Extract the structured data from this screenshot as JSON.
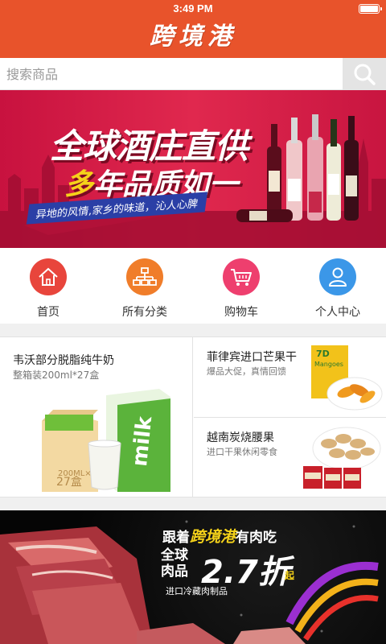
{
  "status_bar": {
    "time": "3:49 PM"
  },
  "header": {
    "title": "跨境港"
  },
  "search": {
    "placeholder": "搜索商品"
  },
  "banner_top": {
    "line1": "全球酒庄直供",
    "line2_highlight": "多",
    "line2_rest": "年品质如一",
    "subtitle": "异地的风情,家乡的味道，沁人心脾"
  },
  "nav": {
    "items": [
      {
        "label": "首页",
        "icon": "home-icon",
        "color": "#e8453c"
      },
      {
        "label": "所有分类",
        "icon": "category-icon",
        "color": "#f07d2a"
      },
      {
        "label": "购物车",
        "icon": "cart-icon",
        "color": "#ee3f6e"
      },
      {
        "label": "个人中心",
        "icon": "user-icon",
        "color": "#3b97e8"
      }
    ]
  },
  "products": {
    "left": {
      "title": "韦沃部分脱脂纯牛奶",
      "subtitle": "整箱装200ml*27盒",
      "box_volume": "200ML×",
      "box_count": "27盒",
      "carton_text": "milk"
    },
    "right_top": {
      "title": "菲律宾进口芒果干",
      "subtitle": "爆品大促，真情回馈",
      "pack_brand": "7D",
      "pack_name": "Mangoes"
    },
    "right_bottom": {
      "title": "越南炭烧腰果",
      "subtitle": "进口干果休闲零食"
    }
  },
  "banner_bottom": {
    "line1_pre": "跟着",
    "line1_highlight": "跨境港",
    "line1_post": "有肉吃",
    "qiu": "全球\n肉品",
    "big": "2.7折",
    "qi": "起",
    "subtitle": "进口冷藏肉制品"
  }
}
